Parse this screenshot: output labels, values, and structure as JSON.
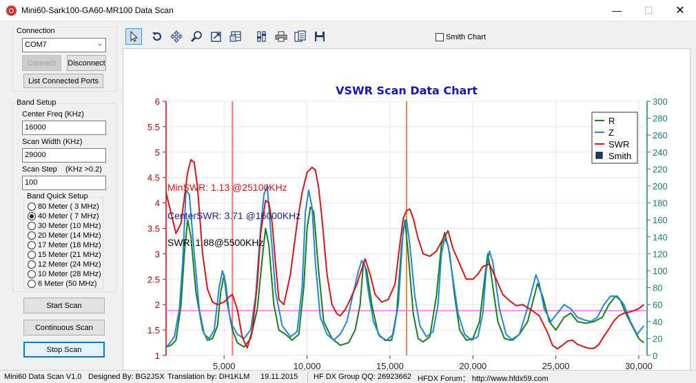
{
  "window": {
    "title": "Mini60-Sark100-GA60-MR100 Data Scan",
    "min_glyph": "—",
    "max_glyph": "☐",
    "close_glyph": "✕"
  },
  "connection": {
    "label": "Connection",
    "port_value": "COM7",
    "connect_label": "Connect",
    "disconnect_label": "Disconnect",
    "list_ports_label": "List Connected Ports"
  },
  "band_setup": {
    "label": "Band Setup",
    "center_freq_label": "Center Freq  (KHz)",
    "center_freq_value": "16000",
    "scan_width_label": "Scan Width   (KHz)",
    "scan_width_value": "29000",
    "scan_step_label": "Scan Step",
    "scan_step_hint": "(KHz >0.2)",
    "scan_step_value": "100",
    "quick_label": "Band Quick Setup",
    "bands": [
      {
        "label": "80 Meter (  3 MHz)",
        "checked": false
      },
      {
        "label": "40 Meter (  7 MHz)",
        "checked": true
      },
      {
        "label": "30 Meter (10 MHz)",
        "checked": false
      },
      {
        "label": "20 Meter (14 MHz)",
        "checked": false
      },
      {
        "label": "17 Meter (18 MHz)",
        "checked": false
      },
      {
        "label": "15 Meter (21 MHz)",
        "checked": false
      },
      {
        "label": "12 Meter (24 MHz)",
        "checked": false
      },
      {
        "label": "10 Meter (28 MHz)",
        "checked": false
      },
      {
        "label": "  6 Meter  (50 MHz)",
        "checked": false
      }
    ]
  },
  "actions": {
    "start_label": "Start Scan",
    "continuous_label": "Continuous Scan",
    "stop_label": "Stop Scan"
  },
  "toolbar": {
    "tools": [
      "pointer-icon",
      "rotate-icon",
      "move-icon",
      "zoom-icon",
      "export-icon",
      "table-icon",
      "properties-icon",
      "print-icon",
      "copy-icon",
      "save-icon"
    ],
    "smith_chart_label": "Smith Chart",
    "smith_chart_checked": false
  },
  "status_bar": {
    "version": "Mini60 Data Scan V1.0",
    "designer": "Designed By: BG2JSX",
    "translation": "Translation by: DH1KLM",
    "date": "19.11.2015",
    "group": "HF DX Group QQ: 26923662",
    "forum": "HFDX Forum：  http://www.hfdx59.com"
  },
  "chart_data": {
    "type": "line",
    "title": "VSWR Scan Data Chart",
    "xlim": [
      1500,
      30500
    ],
    "ylim_left": [
      1,
      6
    ],
    "ylim_right": [
      0,
      300
    ],
    "x_ticks": [
      "5,000",
      "10,000",
      "15,000",
      "20,000",
      "25,000",
      "30,000"
    ],
    "x_tick_values": [
      5000,
      10000,
      15000,
      20000,
      25000,
      30000
    ],
    "y_left_ticks": [
      "1",
      "1.5",
      "2",
      "2.5",
      "3",
      "3.5",
      "4",
      "4.5",
      "5",
      "5.5",
      "6"
    ],
    "y_right_ticks": [
      "0",
      "20",
      "40",
      "60",
      "80",
      "100",
      "120",
      "140",
      "160",
      "180",
      "200",
      "220",
      "240",
      "260",
      "280",
      "300"
    ],
    "grid": true,
    "legend_position": "top-right",
    "legend": [
      {
        "name": "R",
        "color": "#138013"
      },
      {
        "name": "Z",
        "color": "#1a86e0"
      },
      {
        "name": "SWR",
        "color": "#e01010"
      },
      {
        "name": "Smith",
        "color": "#1f3f6f"
      }
    ],
    "annotations": [
      {
        "text": "MinSWR: 1.13 @25100KHz",
        "color": "#e01010"
      },
      {
        "text": "CenterSWR: 3.71 @16000KHz",
        "color": "#1a1a8c"
      },
      {
        "text": "SWR: 1.88@5500KHz",
        "color": "#000000"
      }
    ],
    "markers": [
      {
        "x": 5500,
        "color": "#ff7070"
      },
      {
        "x": 16000,
        "color": "#f08a40"
      }
    ],
    "hline": {
      "y": 1.88,
      "color": "#ff66ff"
    },
    "series": [
      {
        "name": "SWR",
        "axis": "left",
        "color": "#e01010",
        "x": [
          1500,
          1800,
          2100,
          2400,
          2600,
          2800,
          3000,
          3200,
          3400,
          3700,
          4000,
          4300,
          4600,
          5000,
          5300,
          5500,
          5800,
          6100,
          6400,
          6700,
          7000,
          7200,
          7500,
          7700,
          7900,
          8100,
          8300,
          8600,
          9000,
          9400,
          9700,
          10000,
          10300,
          10500,
          10700,
          10900,
          11200,
          11500,
          11800,
          12000,
          12300,
          12600,
          13000,
          13300,
          13500,
          13800,
          14100,
          14500,
          14900,
          15300,
          15600,
          15800,
          16000,
          16200,
          16400,
          16700,
          17000,
          17400,
          17800,
          18200,
          18500,
          18800,
          19200,
          19600,
          20000,
          20300,
          20600,
          21000,
          21400,
          21800,
          22200,
          22600,
          23000,
          23500,
          24000,
          24500,
          24800,
          25100,
          25400,
          25700,
          26000,
          26300,
          26700,
          27000,
          27300,
          27600,
          27900,
          28200,
          28500,
          28800,
          29100,
          29400,
          29700,
          30000,
          30300
        ],
        "y": [
          4.2,
          3.8,
          3.4,
          3.6,
          4.1,
          4.6,
          4.85,
          4.8,
          4.3,
          3.0,
          2.3,
          2.05,
          2.0,
          2.05,
          2.15,
          2.2,
          1.9,
          1.35,
          1.15,
          1.5,
          2.4,
          3.4,
          4.05,
          4.0,
          3.6,
          2.8,
          2.1,
          2.0,
          2.6,
          3.6,
          4.2,
          4.6,
          4.7,
          4.65,
          4.3,
          3.7,
          2.6,
          2.0,
          1.82,
          1.78,
          1.9,
          2.1,
          2.4,
          2.7,
          2.9,
          2.6,
          2.2,
          2.05,
          2.1,
          2.4,
          3.2,
          3.7,
          3.85,
          3.88,
          3.7,
          3.3,
          3.0,
          2.95,
          3.05,
          3.3,
          3.45,
          3.1,
          2.8,
          2.5,
          2.5,
          2.6,
          2.75,
          2.8,
          2.5,
          2.2,
          2.08,
          1.98,
          2.0,
          1.9,
          1.78,
          1.45,
          1.2,
          1.13,
          1.2,
          1.28,
          1.3,
          1.22,
          1.17,
          1.14,
          1.14,
          1.22,
          1.38,
          1.52,
          1.68,
          1.78,
          1.83,
          1.85,
          1.88,
          1.92,
          2.0
        ]
      },
      {
        "name": "R",
        "axis": "right",
        "color": "#138013",
        "x": [
          1500,
          1800,
          2100,
          2400,
          2600,
          2800,
          3000,
          3300,
          3700,
          4000,
          4300,
          4600,
          4800,
          5000,
          5200,
          5500,
          5800,
          6200,
          6600,
          7000,
          7300,
          7500,
          7700,
          8000,
          8300,
          8700,
          9100,
          9500,
          9800,
          10000,
          10200,
          10400,
          10700,
          11000,
          11500,
          12000,
          12500,
          12900,
          13200,
          13400,
          13600,
          13900,
          14300,
          14700,
          15100,
          15400,
          15700,
          15900,
          16100,
          16400,
          16700,
          17000,
          17400,
          17800,
          18100,
          18300,
          18600,
          18900,
          19200,
          19600,
          20000,
          20400,
          20700,
          20900,
          21100,
          21500,
          21900,
          22300,
          22800,
          23300,
          23700,
          23900,
          24200,
          24600,
          25000,
          25500,
          25900,
          26300,
          26800,
          27300,
          27800,
          28200,
          28600,
          28900,
          29200,
          29600,
          30000,
          30300
        ],
        "y": [
          10,
          12,
          18,
          60,
          120,
          160,
          140,
          75,
          30,
          18,
          20,
          35,
          75,
          95,
          60,
          30,
          15,
          10,
          20,
          55,
          115,
          150,
          130,
          60,
          30,
          25,
          18,
          25,
          80,
          150,
          175,
          170,
          100,
          40,
          20,
          12,
          15,
          30,
          60,
          110,
          100,
          60,
          25,
          18,
          18,
          50,
          130,
          160,
          120,
          50,
          20,
          16,
          22,
          70,
          130,
          145,
          120,
          70,
          30,
          18,
          20,
          40,
          90,
          120,
          95,
          40,
          20,
          18,
          25,
          40,
          70,
          85,
          70,
          40,
          30,
          45,
          50,
          40,
          38,
          40,
          45,
          60,
          70,
          65,
          50,
          35,
          20,
          15
        ]
      },
      {
        "name": "Z",
        "axis": "right",
        "color": "#1a86e0",
        "x": [
          1500,
          1700,
          2000,
          2300,
          2500,
          2700,
          2900,
          3200,
          3500,
          3800,
          4100,
          4400,
          4700,
          4900,
          5100,
          5300,
          5500,
          5800,
          6200,
          6600,
          6900,
          7200,
          7400,
          7600,
          7800,
          8100,
          8500,
          9000,
          9400,
          9700,
          9900,
          10100,
          10300,
          10500,
          10800,
          11200,
          11600,
          12000,
          12400,
          12800,
          13100,
          13300,
          13500,
          13700,
          14000,
          14400,
          14800,
          15200,
          15500,
          15800,
          16000,
          16200,
          16500,
          16800,
          17200,
          17600,
          17900,
          18100,
          18300,
          18500,
          18800,
          19100,
          19500,
          19900,
          20300,
          20600,
          20800,
          21000,
          21200,
          21600,
          22000,
          22400,
          22800,
          23200,
          23600,
          23800,
          24000,
          24300,
          24700,
          25100,
          25500,
          25900,
          26300,
          26700,
          27100,
          27500,
          27900,
          28300,
          28700,
          29100,
          29500,
          29900,
          30300
        ],
        "y": [
          10,
          14,
          22,
          55,
          110,
          195,
          190,
          120,
          55,
          25,
          20,
          30,
          80,
          100,
          85,
          50,
          35,
          25,
          20,
          30,
          70,
          150,
          190,
          200,
          150,
          75,
          35,
          22,
          28,
          80,
          170,
          195,
          175,
          110,
          45,
          25,
          18,
          25,
          40,
          75,
          100,
          112,
          105,
          75,
          40,
          22,
          18,
          25,
          60,
          150,
          160,
          130,
          70,
          35,
          22,
          28,
          60,
          120,
          138,
          130,
          90,
          50,
          25,
          18,
          22,
          50,
          100,
          123,
          110,
          55,
          25,
          18,
          25,
          50,
          80,
          95,
          85,
          55,
          40,
          50,
          60,
          55,
          45,
          42,
          40,
          45,
          60,
          70,
          70,
          60,
          40,
          25,
          35
        ]
      }
    ]
  }
}
